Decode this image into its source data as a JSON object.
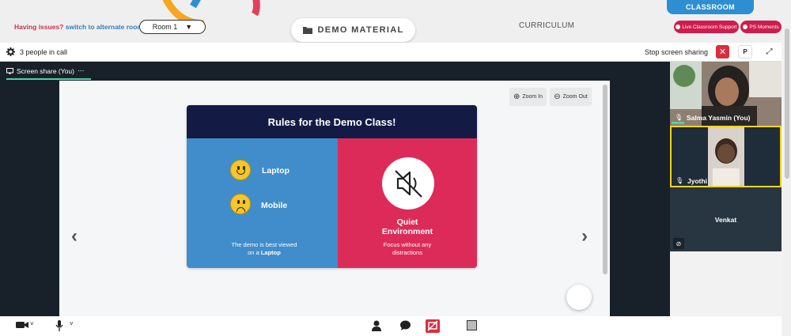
{
  "topbar": {
    "issues_text": "Having issues?",
    "alternate_room_link": "switch to alternate room",
    "room_select_value": "Room 1",
    "demo_material_label": "DEMO MATERIAL",
    "curriculum_label": "CURRICULUM",
    "classroom_tab_label": "CLASSROOM",
    "live_support_label": "Live Classroom Support",
    "ps_moments_label": "PS Moments"
  },
  "callbar": {
    "people_count": "3 people in call",
    "stop_sharing_label": "Stop screen sharing",
    "p_button_label": "P"
  },
  "meeting": {
    "share_tab_label": "Screen share (You)",
    "share_tab_more": "⋯",
    "zoom_in_label": "Zoom In",
    "zoom_out_label": "Zoom Out"
  },
  "slide": {
    "title": "Rules for the Demo Class!",
    "laptop_label": "Laptop",
    "mobile_label": "Mobile",
    "note_line1": "The demo is best viewed",
    "note_line2_prefix": "on a",
    "note_line2_bold": "Laptop",
    "quiet_line1": "Quiet",
    "quiet_line2": "Environment",
    "quiet_desc_line1": "Focus without any",
    "quiet_desc_line2": "distractions"
  },
  "participants": [
    {
      "name": "Salma Yasmin (You)"
    },
    {
      "name": "Jyothi"
    },
    {
      "name": "Venkat"
    }
  ],
  "colors": {
    "accent_blue": "#2d8ed1",
    "brand_red": "#cf1c4c",
    "meeting_dark": "#18212a",
    "active_speaker": "#f2d31c"
  }
}
